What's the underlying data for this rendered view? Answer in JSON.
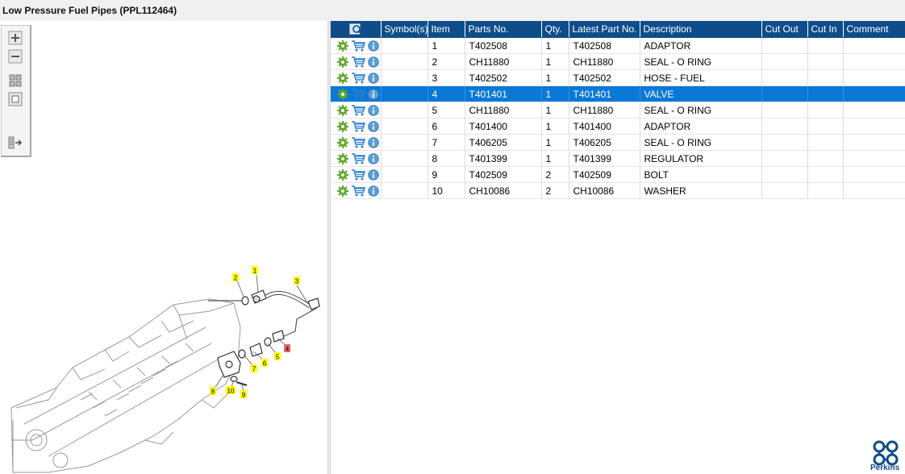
{
  "window": {
    "title": "Low Pressure Fuel Pipes (PPL112464)"
  },
  "toolbox": {
    "buttons": [
      "zoom-in",
      "zoom-out",
      "fit-all",
      "fit-window",
      "toggle-panel"
    ]
  },
  "table": {
    "columns": [
      "Symbol(s)",
      "Item",
      "Parts No.",
      "Qty.",
      "Latest Part No.",
      "Description",
      "Cut Out",
      "Cut In",
      "Comment"
    ],
    "rows": [
      {
        "symbol": "",
        "item": "1",
        "part": "T402508",
        "qty": "1",
        "latest": "T402508",
        "desc": "ADAPTOR",
        "cutout": "",
        "cutin": "",
        "comment": ""
      },
      {
        "symbol": "",
        "item": "2",
        "part": "CH11880",
        "qty": "1",
        "latest": "CH11880",
        "desc": "SEAL - O RING",
        "cutout": "",
        "cutin": "",
        "comment": ""
      },
      {
        "symbol": "",
        "item": "3",
        "part": "T402502",
        "qty": "1",
        "latest": "T402502",
        "desc": "HOSE - FUEL",
        "cutout": "",
        "cutin": "",
        "comment": ""
      },
      {
        "symbol": "",
        "item": "4",
        "part": "T401401",
        "qty": "1",
        "latest": "T401401",
        "desc": "VALVE",
        "cutout": "",
        "cutin": "",
        "comment": ""
      },
      {
        "symbol": "",
        "item": "5",
        "part": "CH11880",
        "qty": "1",
        "latest": "CH11880",
        "desc": "SEAL - O RING",
        "cutout": "",
        "cutin": "",
        "comment": ""
      },
      {
        "symbol": "",
        "item": "6",
        "part": "T401400",
        "qty": "1",
        "latest": "T401400",
        "desc": "ADAPTOR",
        "cutout": "",
        "cutin": "",
        "comment": ""
      },
      {
        "symbol": "",
        "item": "7",
        "part": "T406205",
        "qty": "1",
        "latest": "T406205",
        "desc": "SEAL - O RING",
        "cutout": "",
        "cutin": "",
        "comment": ""
      },
      {
        "symbol": "",
        "item": "8",
        "part": "T401399",
        "qty": "1",
        "latest": "T401399",
        "desc": "REGULATOR",
        "cutout": "",
        "cutin": "",
        "comment": ""
      },
      {
        "symbol": "",
        "item": "9",
        "part": "T402509",
        "qty": "2",
        "latest": "T402509",
        "desc": "BOLT",
        "cutout": "",
        "cutin": "",
        "comment": ""
      },
      {
        "symbol": "",
        "item": "10",
        "part": "CH10086",
        "qty": "2",
        "latest": "CH10086",
        "desc": "WASHER",
        "cutout": "",
        "cutin": "",
        "comment": ""
      }
    ],
    "selected_item": "4"
  },
  "callouts": [
    {
      "label": "1",
      "highlight": false
    },
    {
      "label": "2",
      "highlight": false
    },
    {
      "label": "3",
      "highlight": false
    },
    {
      "label": "4",
      "highlight": true
    },
    {
      "label": "5",
      "highlight": false
    },
    {
      "label": "6",
      "highlight": false
    },
    {
      "label": "7",
      "highlight": false
    },
    {
      "label": "8",
      "highlight": false
    },
    {
      "label": "9",
      "highlight": false
    },
    {
      "label": "10",
      "highlight": false
    }
  ],
  "brand": {
    "name": "Perkins",
    "color": "#0f4d8a"
  },
  "colors": {
    "header": "#0f4d8a",
    "selection": "#0a78d7",
    "callout": "#ffff00",
    "callout_active": "#e8646e"
  }
}
